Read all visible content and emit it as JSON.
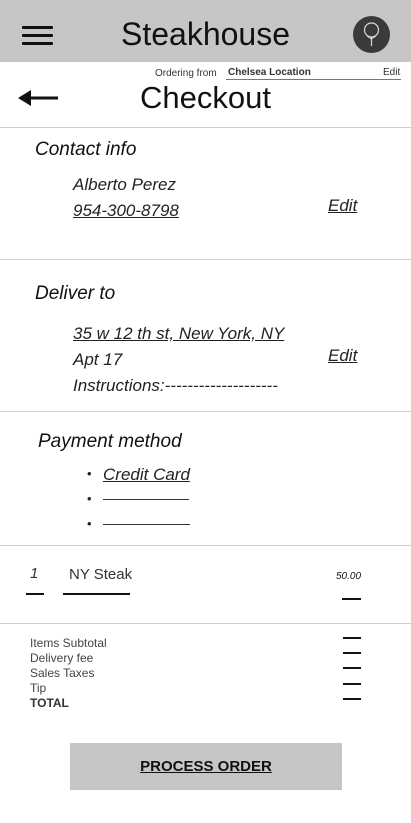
{
  "header": {
    "title": "Steakhouse",
    "icons": {
      "menu": "hamburger-menu-icon",
      "avatar": "user-avatar-icon"
    }
  },
  "location_bar": {
    "prefix": "Ordering from",
    "location": "Chelsea Location",
    "edit_label": "Edit"
  },
  "page": {
    "title": "Checkout",
    "back_icon": "left-arrow-icon"
  },
  "contact": {
    "title": "Contact info",
    "name": "Alberto Perez",
    "phone": "954-300-8798",
    "edit_label": "Edit"
  },
  "delivery": {
    "title": "Deliver to",
    "address": "35 w 12 th st, New York, NY",
    "apt": "Apt 17",
    "instructions": "Instructions:--------------------",
    "edit_label": "Edit"
  },
  "payment": {
    "title": "Payment method",
    "options": [
      {
        "bullet": "•",
        "label": "Credit Card"
      },
      {
        "bullet": "•",
        "label": ""
      },
      {
        "bullet": "•",
        "label": ""
      }
    ]
  },
  "order": {
    "items": [
      {
        "qty": "1",
        "name": "NY Steak",
        "price": "50.00"
      }
    ]
  },
  "totals": {
    "items_subtotal": "Items Subtotal",
    "delivery_fee": "Delivery fee",
    "sales_taxes": "Sales Taxes",
    "tip": "Tip",
    "total": "TOTAL"
  },
  "actions": {
    "process_order": "PROCESS ORDER"
  },
  "colors": {
    "header_bg": "#c6c6c6",
    "button_bg": "#c6c6c6",
    "text": "#111111"
  }
}
